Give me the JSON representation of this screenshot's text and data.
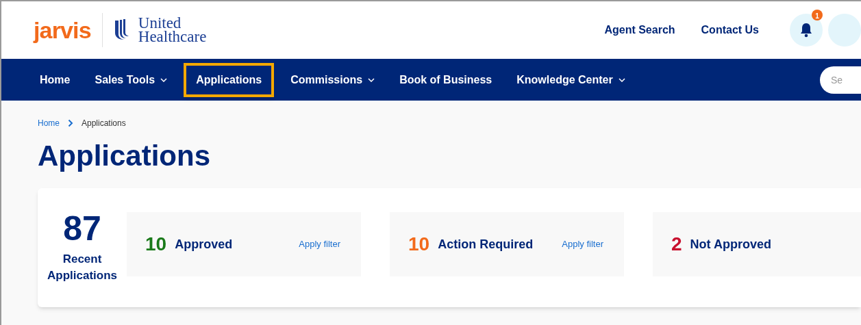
{
  "header": {
    "logo": "jarvis",
    "partner": [
      "United",
      "Healthcare"
    ],
    "links": [
      "Agent Search",
      "Contact Us"
    ],
    "notification_badge": "1"
  },
  "nav": {
    "items": [
      {
        "label": "Home",
        "has_menu": false,
        "selected": false
      },
      {
        "label": "Sales Tools",
        "has_menu": true,
        "selected": false
      },
      {
        "label": "Applications",
        "has_menu": false,
        "selected": true
      },
      {
        "label": "Commissions",
        "has_menu": true,
        "selected": false
      },
      {
        "label": "Book of Business",
        "has_menu": false,
        "selected": false
      },
      {
        "label": "Knowledge Center",
        "has_menu": true,
        "selected": false
      }
    ],
    "search": {
      "placeholder": "Se"
    }
  },
  "breadcrumb": [
    "Home",
    "Applications"
  ],
  "title": "Applications",
  "summary": {
    "total": "87",
    "total_label": "Recent Applications",
    "stats": [
      {
        "count": "10",
        "label": "Approved",
        "color": "#1a7a1a",
        "action": "Apply filter"
      },
      {
        "count": "10",
        "label": "Action Required",
        "color": "#f26a1b",
        "action": "Apply filter"
      },
      {
        "count": "2",
        "label": "Not Approved",
        "color": "#c8102e"
      }
    ]
  }
}
